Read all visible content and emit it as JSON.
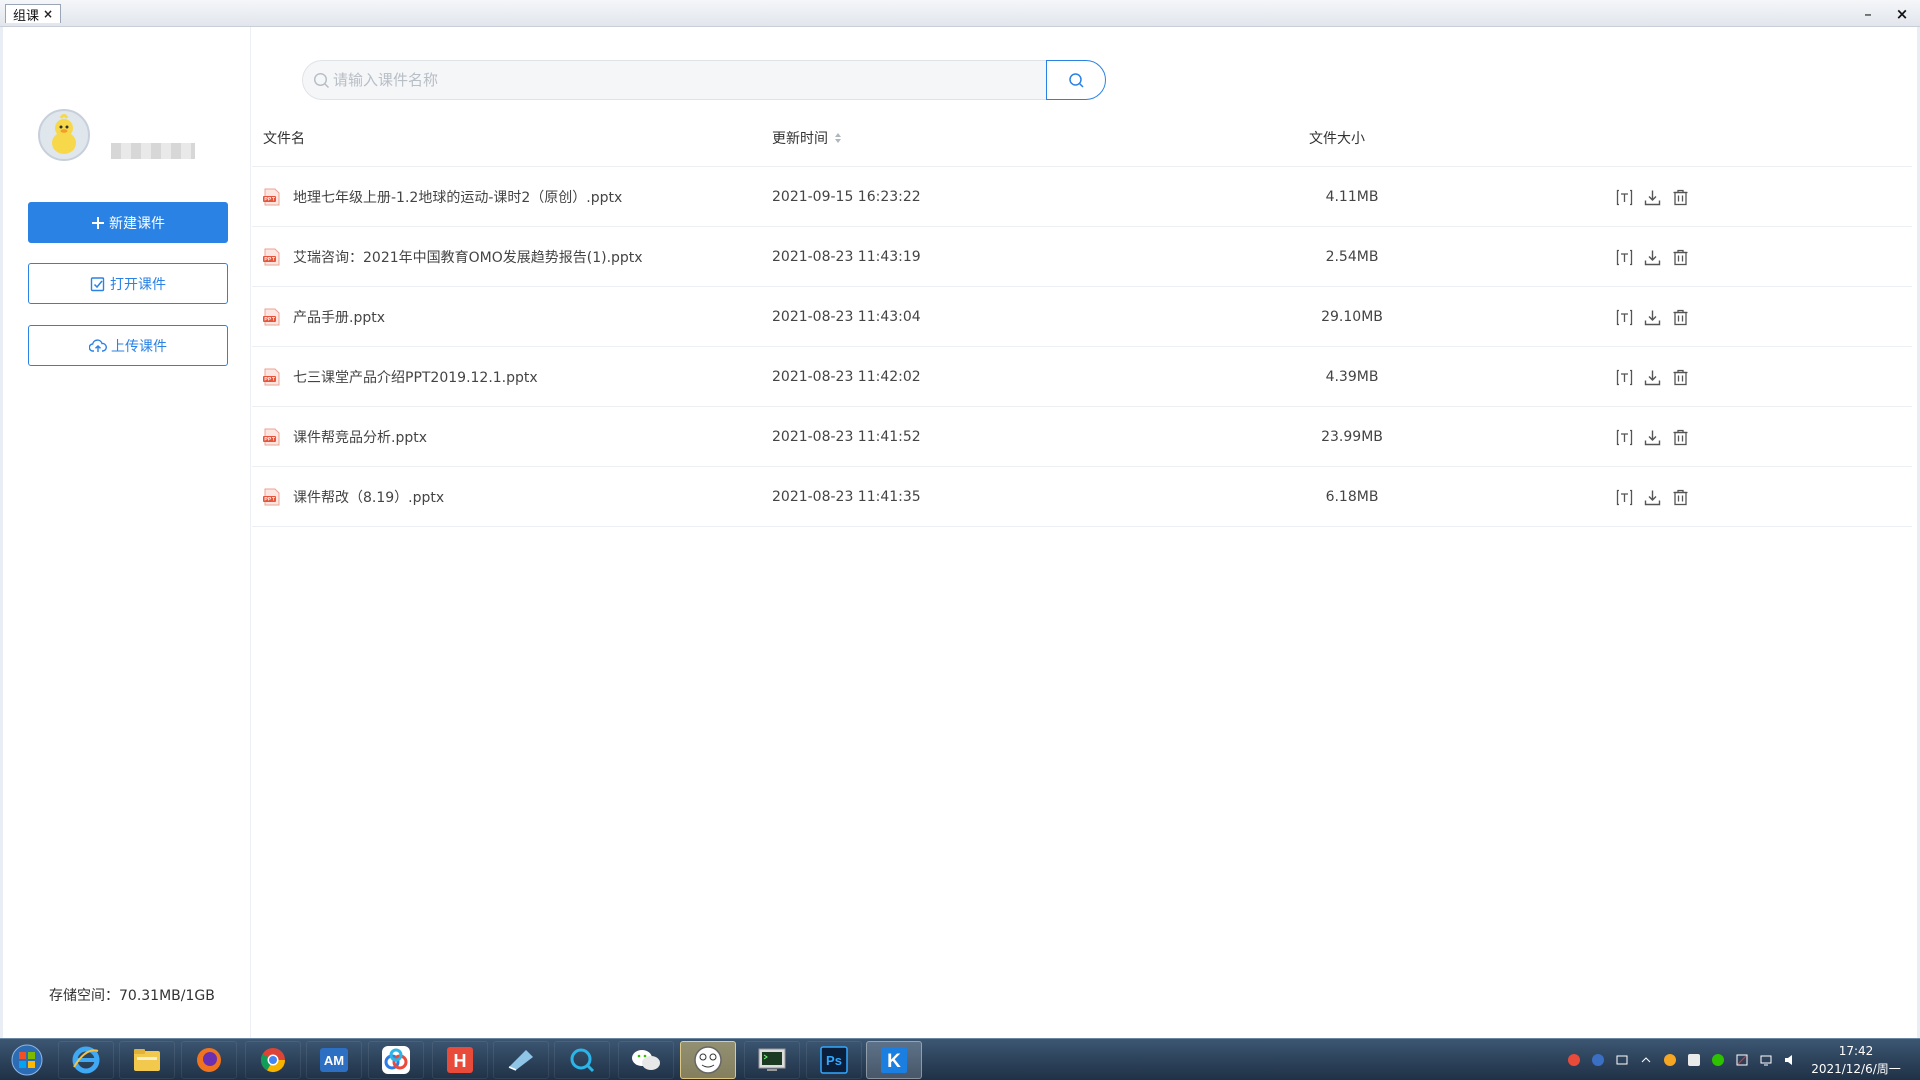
{
  "window": {
    "tab_title": "组课",
    "tab_close": "×",
    "minimize": "–",
    "close": "×"
  },
  "sidebar": {
    "new_button": "新建课件",
    "open_button": "打开课件",
    "upload_button": "上传课件",
    "storage": "存储空间：70.31MB/1GB"
  },
  "search": {
    "placeholder": "请输入课件名称",
    "value": ""
  },
  "table": {
    "headers": {
      "name": "文件名",
      "time": "更新时间",
      "size": "文件大小"
    },
    "rows": [
      {
        "name": "地理七年级上册-1.2地球的运动-课时2（原创）.pptx",
        "time": "2021-09-15 16:23:22",
        "size": "4.11MB"
      },
      {
        "name": "艾瑞咨询：2021年中国教育OMO发展趋势报告(1).pptx",
        "time": "2021-08-23 11:43:19",
        "size": "2.54MB"
      },
      {
        "name": "产品手册.pptx",
        "time": "2021-08-23 11:43:04",
        "size": "29.10MB"
      },
      {
        "name": "七三课堂产品介绍PPT2019.12.1.pptx",
        "time": "2021-08-23 11:42:02",
        "size": "4.39MB"
      },
      {
        "name": "课件帮竞品分析.pptx",
        "time": "2021-08-23 11:41:52",
        "size": "23.99MB"
      },
      {
        "name": "课件帮改（8.19）.pptx",
        "time": "2021-08-23 11:41:35",
        "size": "6.18MB"
      }
    ],
    "actions": [
      "rename-icon",
      "download-icon",
      "delete-icon"
    ]
  },
  "taskbar": {
    "apps": [
      {
        "name": "ie",
        "label": "e"
      },
      {
        "name": "explorer",
        "label": ""
      },
      {
        "name": "firefox",
        "label": ""
      },
      {
        "name": "chrome",
        "label": ""
      },
      {
        "name": "am",
        "label": "AM"
      },
      {
        "name": "baidu-netdisk",
        "label": ""
      },
      {
        "name": "hbuilder",
        "label": "H"
      },
      {
        "name": "notes",
        "label": ""
      },
      {
        "name": "search-app",
        "label": ""
      },
      {
        "name": "wechat",
        "label": ""
      },
      {
        "name": "qq-pet",
        "label": ""
      },
      {
        "name": "terminal",
        "label": ""
      },
      {
        "name": "photoshop",
        "label": "Ps"
      },
      {
        "name": "kuaike",
        "label": "K"
      }
    ],
    "clock_time": "17:42",
    "clock_date": "2021/12/6/周一"
  },
  "colors": {
    "accent": "#2a82e4",
    "file_icon": "#e8543a"
  }
}
